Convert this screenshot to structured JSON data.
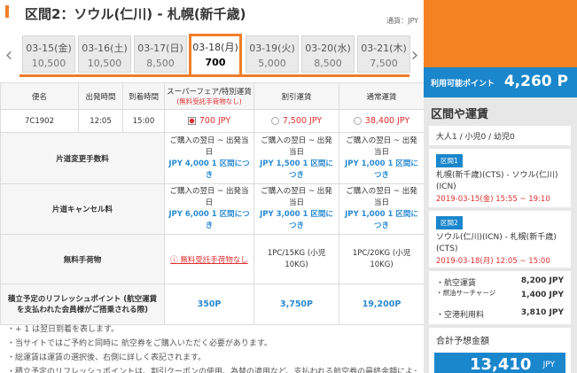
{
  "section": {
    "title": "区間2：ソウル(仁川) - 札幌(新千歳)",
    "currency": "通貨：JPY"
  },
  "dates": [
    {
      "date": "03-15(金)",
      "price": "10,500",
      "active": false
    },
    {
      "date": "03-16(土)",
      "price": "10,500",
      "active": false
    },
    {
      "date": "03-17(日)",
      "price": "8,500",
      "active": false
    },
    {
      "date": "03-18(月)",
      "price": "700",
      "active": true
    },
    {
      "date": "03-19(火)",
      "price": "5,000",
      "active": false
    },
    {
      "date": "03-20(水)",
      "price": "8,500",
      "active": false
    },
    {
      "date": "03-21(木)",
      "price": "7,500",
      "active": false
    }
  ],
  "table": {
    "headers": {
      "flight": "便名",
      "depart": "出発時間",
      "arrive": "到着時間",
      "super_line1": "スーパーフェア/特別運賃",
      "super_line2": "(無料受託手荷物なし)",
      "discount": "割引運賃",
      "normal": "通常運賃"
    },
    "flight": {
      "number": "7C1902",
      "depart": "12:05",
      "arrive": "15:00",
      "super_price": "700 JPY",
      "discount_price": "7,500 JPY",
      "normal_price": "38,400 JPY"
    },
    "change": {
      "label": "片道変更手数料",
      "cond": "ご購入の翌日 ~ 出発当日",
      "super": "JPY 4,000 1 区間につき",
      "discount": "JPY 1,500 1 区間につき",
      "normal": "JPY 1,000 1 区間につき"
    },
    "cancel": {
      "label": "片道キャンセル料",
      "cond": "ご購入の翌日 ~ 出発当日",
      "super": "JPY 6,000 1 区間につき",
      "discount": "JPY 3,000 1 区間につき",
      "normal": "JPY 1,000 1 区間につき"
    },
    "baggage": {
      "label": "無料手荷物",
      "super": "ⓘ 無料受託手荷物なし",
      "discount": "1PC/15KG (小児 10KG)",
      "normal": "1PC/20KG (小児 10KG)"
    },
    "points": {
      "label": "積立予定のリフレッシュポイント (航空運賃を支払われた会員様がご搭乗される際)",
      "super": "350P",
      "discount": "3,750P",
      "normal": "19,200P"
    }
  },
  "notes": [
    "・+ 1 は翌日到着を表します。",
    "・当サイトではご予約と同時に 航空券をご購入いただく必要があります。",
    "・総運賃は運賃の選択後、右側に詳しく表記されます。",
    "・積立予定のリフレッシュポイントは、割引クーポンの使用、為替の適用など、支払われる航空券の最終金額によっ"
  ],
  "sidebar": {
    "points_label": "利用可能ポイント",
    "points_value": "4,260 P",
    "title": "区間や運賃",
    "pax": "大人1 / 小児0 / 幼児0",
    "segments": [
      {
        "tag": "区間1",
        "route": "札幌(新千歳)(CTS) - ソウル(仁川)(ICN)",
        "when": "2019-03-15(金) 15:55 ~ 19:10"
      },
      {
        "tag": "区間2",
        "route": "ソウル(仁川)(ICN) - 札幌(新千歳)(CTS)",
        "when": "2019-03-18(月) 12:05 ~ 15:00"
      }
    ],
    "fees": [
      {
        "label": "・航空運賃",
        "value": "8,200 JPY"
      },
      {
        "label": "・燃油サーチャージ",
        "value": "1,400 JPY"
      },
      {
        "label": "・空港利用料",
        "value": "3,810 JPY"
      }
    ],
    "total_label": "合計予想金額",
    "total_value": "13,410",
    "total_currency": "JPY"
  },
  "colors": {
    "accent": "#f07e2a",
    "blue": "#1a86cc",
    "red": "#e03030"
  }
}
